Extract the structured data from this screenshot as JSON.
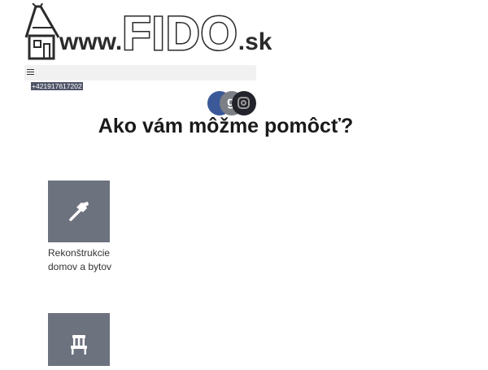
{
  "logo": {
    "www": "www.",
    "name": "FIDO",
    "tld": ".sk",
    "icon": "house-icon"
  },
  "nav": {
    "menu_icon": "hamburger-icon"
  },
  "contact": {
    "phone": "+421917617202"
  },
  "social": [
    {
      "name": "facebook",
      "icon": "facebook-icon",
      "color": "#3b5998"
    },
    {
      "name": "google-plus",
      "icon": "google-plus-icon",
      "glyph": "g",
      "color": "#7d7f86"
    },
    {
      "name": "instagram",
      "icon": "instagram-icon",
      "color": "#23232b"
    }
  ],
  "main": {
    "heading": "Ako vám môžme pomôcť?",
    "services": [
      {
        "label": "Rekonštrukcie domov a bytov",
        "icon": "hammer-icon"
      },
      {
        "label": "",
        "icon": "chair-icon"
      }
    ]
  },
  "colors": {
    "tile": "#6d727f",
    "phone_badge": "#4f5468",
    "navbar": "#f1f1f1"
  }
}
